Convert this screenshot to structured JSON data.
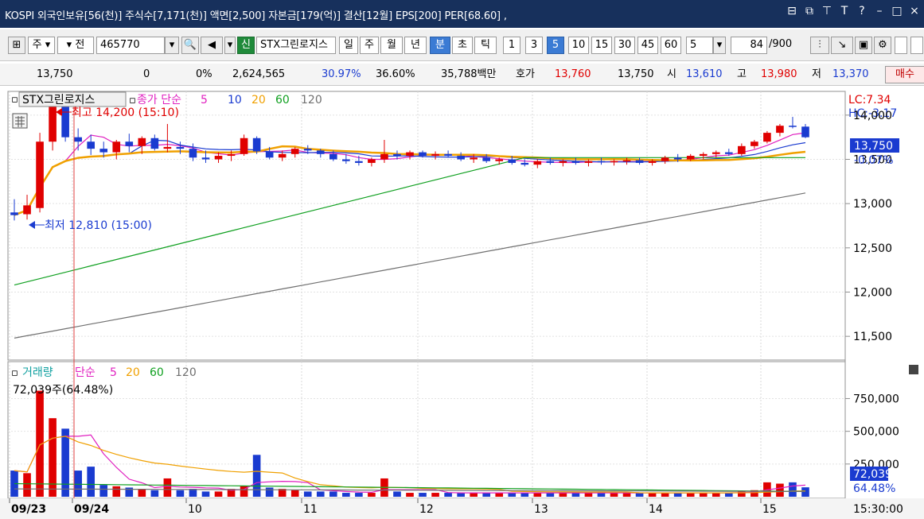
{
  "titlebar": {
    "text": "KOSPI 외국인보유[56(천)] 주식수[7,171(천)] 액면[2,500] 자본금[179(억)] 결산[12월] EPS[200] PER[68.60] ,",
    "icons": [
      "split-icon",
      "popup-icon",
      "pin-icon",
      "font-icon",
      "help-icon",
      "minimize-icon",
      "maximize-icon",
      "close-icon"
    ]
  },
  "toolbar": {
    "period_ju": "주",
    "jeon": "전",
    "stock_code": "465770",
    "shin": "신",
    "stock_name": "STX그린로지스",
    "periods": [
      "일",
      "주",
      "월",
      "년",
      "분",
      "초",
      "틱"
    ],
    "minutes": [
      "1",
      "3",
      "5",
      "10",
      "15",
      "30",
      "45",
      "60"
    ],
    "selected_period": "분",
    "selected_minute": "5",
    "interval_value": "5",
    "count": "84",
    "total": "/900"
  },
  "quote": {
    "price": "13,750",
    "change": "0",
    "change_pct": "0%",
    "volume": "2,624,565",
    "vol_ratio": "30.97%",
    "turnover": "36.60%",
    "amount": "35,788백만",
    "hoga_label": "호가",
    "hoga_ask": "13,760",
    "hoga_bid": "13,750",
    "open_label": "시",
    "open": "13,610",
    "high_label": "고",
    "high": "13,980",
    "low_label": "저",
    "low": "13,370",
    "buy_label": "매수"
  },
  "price_panel": {
    "name": "STX그린로지스",
    "legend_prefix": "종가 단순",
    "ma": [
      "5",
      "10",
      "20",
      "60",
      "120"
    ],
    "ma_colors": [
      "#e020c0",
      "#1a3bd0",
      "#f0a000",
      "#10a020",
      "#707070"
    ],
    "high_note": "최고 14,200 (15:10)",
    "low_note": "최저 12,810 (15:00)",
    "lc": "LC:7.34",
    "hc": "HC:-3.17",
    "price_tag": "13,750",
    "price_tag_pct": "-0.07%",
    "yaxis": [
      "14,000",
      "13,500",
      "13,000",
      "12,500",
      "12,000",
      "11,500"
    ]
  },
  "volume_panel": {
    "name": "거래량",
    "legend_prefix": "단순",
    "ma": [
      "5",
      "20",
      "60",
      "120"
    ],
    "info": "72,039주(64.48%)",
    "yaxis": [
      "750,000",
      "500,000",
      "250,000"
    ],
    "vol_tag": "72,039",
    "vol_tag_pct": "64.48%"
  },
  "xaxis": [
    "09/23",
    "09/24",
    "10",
    "11",
    "12",
    "13",
    "14",
    "15"
  ],
  "time_label": "15:30:00",
  "chart_data": {
    "type": "candlestick",
    "price_ylim": [
      11250,
      14250
    ],
    "volume_ylim": [
      0,
      850000
    ],
    "candles": [
      {
        "o": 12900,
        "h": 13050,
        "l": 12810,
        "c": 12870,
        "v": 200000
      },
      {
        "o": 12880,
        "h": 13100,
        "l": 12820,
        "c": 12980,
        "v": 180000
      },
      {
        "o": 12950,
        "h": 13800,
        "l": 12900,
        "c": 13700,
        "v": 810000
      },
      {
        "o": 13700,
        "h": 14200,
        "l": 13600,
        "c": 14100,
        "v": 600000
      },
      {
        "o": 14100,
        "h": 14200,
        "l": 13700,
        "c": 13750,
        "v": 520000
      },
      {
        "o": 13750,
        "h": 13850,
        "l": 13600,
        "c": 13700,
        "v": 200000
      },
      {
        "o": 13700,
        "h": 13780,
        "l": 13550,
        "c": 13620,
        "v": 230000
      },
      {
        "o": 13620,
        "h": 13700,
        "l": 13520,
        "c": 13580,
        "v": 90000
      },
      {
        "o": 13580,
        "h": 13720,
        "l": 13500,
        "c": 13700,
        "v": 80000
      },
      {
        "o": 13700,
        "h": 13790,
        "l": 13580,
        "c": 13650,
        "v": 70000
      },
      {
        "o": 13650,
        "h": 13760,
        "l": 13560,
        "c": 13740,
        "v": 60000
      },
      {
        "o": 13740,
        "h": 13780,
        "l": 13600,
        "c": 13620,
        "v": 50000
      },
      {
        "o": 13620,
        "h": 13900,
        "l": 13580,
        "c": 13640,
        "v": 140000
      },
      {
        "o": 13640,
        "h": 13700,
        "l": 13560,
        "c": 13620,
        "v": 50000
      },
      {
        "o": 13620,
        "h": 13680,
        "l": 13480,
        "c": 13520,
        "v": 60000
      },
      {
        "o": 13520,
        "h": 13600,
        "l": 13460,
        "c": 13500,
        "v": 40000
      },
      {
        "o": 13500,
        "h": 13580,
        "l": 13460,
        "c": 13540,
        "v": 40000
      },
      {
        "o": 13540,
        "h": 13600,
        "l": 13480,
        "c": 13560,
        "v": 60000
      },
      {
        "o": 13560,
        "h": 13780,
        "l": 13540,
        "c": 13740,
        "v": 80000
      },
      {
        "o": 13740,
        "h": 13760,
        "l": 13560,
        "c": 13590,
        "v": 320000
      },
      {
        "o": 13590,
        "h": 13640,
        "l": 13500,
        "c": 13520,
        "v": 70000
      },
      {
        "o": 13520,
        "h": 13600,
        "l": 13480,
        "c": 13560,
        "v": 60000
      },
      {
        "o": 13560,
        "h": 13640,
        "l": 13520,
        "c": 13620,
        "v": 50000
      },
      {
        "o": 13620,
        "h": 13660,
        "l": 13560,
        "c": 13600,
        "v": 40000
      },
      {
        "o": 13600,
        "h": 13620,
        "l": 13520,
        "c": 13560,
        "v": 40000
      },
      {
        "o": 13560,
        "h": 13600,
        "l": 13480,
        "c": 13500,
        "v": 40000
      },
      {
        "o": 13500,
        "h": 13560,
        "l": 13450,
        "c": 13480,
        "v": 30000
      },
      {
        "o": 13480,
        "h": 13540,
        "l": 13430,
        "c": 13460,
        "v": 30000
      },
      {
        "o": 13460,
        "h": 13520,
        "l": 13420,
        "c": 13500,
        "v": 30000
      },
      {
        "o": 13500,
        "h": 13720,
        "l": 13460,
        "c": 13560,
        "v": 140000
      },
      {
        "o": 13560,
        "h": 13600,
        "l": 13500,
        "c": 13540,
        "v": 40000
      },
      {
        "o": 13540,
        "h": 13600,
        "l": 13500,
        "c": 13580,
        "v": 30000
      },
      {
        "o": 13580,
        "h": 13600,
        "l": 13520,
        "c": 13540,
        "v": 30000
      },
      {
        "o": 13540,
        "h": 13590,
        "l": 13500,
        "c": 13560,
        "v": 30000
      },
      {
        "o": 13560,
        "h": 13600,
        "l": 13520,
        "c": 13540,
        "v": 30000
      },
      {
        "o": 13540,
        "h": 13580,
        "l": 13480,
        "c": 13500,
        "v": 30000
      },
      {
        "o": 13500,
        "h": 13560,
        "l": 13460,
        "c": 13520,
        "v": 30000
      },
      {
        "o": 13520,
        "h": 13560,
        "l": 13460,
        "c": 13480,
        "v": 30000
      },
      {
        "o": 13480,
        "h": 13520,
        "l": 13440,
        "c": 13500,
        "v": 30000
      },
      {
        "o": 13500,
        "h": 13540,
        "l": 13440,
        "c": 13460,
        "v": 30000
      },
      {
        "o": 13460,
        "h": 13500,
        "l": 13420,
        "c": 13440,
        "v": 30000
      },
      {
        "o": 13440,
        "h": 13500,
        "l": 13400,
        "c": 13480,
        "v": 30000
      },
      {
        "o": 13480,
        "h": 13520,
        "l": 13440,
        "c": 13460,
        "v": 30000
      },
      {
        "o": 13460,
        "h": 13500,
        "l": 13420,
        "c": 13480,
        "v": 30000
      },
      {
        "o": 13480,
        "h": 13520,
        "l": 13440,
        "c": 13460,
        "v": 30000
      },
      {
        "o": 13460,
        "h": 13500,
        "l": 13420,
        "c": 13480,
        "v": 30000
      },
      {
        "o": 13480,
        "h": 13520,
        "l": 13440,
        "c": 13470,
        "v": 30000
      },
      {
        "o": 13470,
        "h": 13500,
        "l": 13430,
        "c": 13480,
        "v": 30000
      },
      {
        "o": 13480,
        "h": 13520,
        "l": 13440,
        "c": 13490,
        "v": 30000
      },
      {
        "o": 13490,
        "h": 13520,
        "l": 13440,
        "c": 13460,
        "v": 30000
      },
      {
        "o": 13460,
        "h": 13500,
        "l": 13430,
        "c": 13480,
        "v": 30000
      },
      {
        "o": 13480,
        "h": 13540,
        "l": 13450,
        "c": 13520,
        "v": 30000
      },
      {
        "o": 13520,
        "h": 13560,
        "l": 13470,
        "c": 13500,
        "v": 30000
      },
      {
        "o": 13500,
        "h": 13560,
        "l": 13480,
        "c": 13540,
        "v": 30000
      },
      {
        "o": 13540,
        "h": 13580,
        "l": 13500,
        "c": 13560,
        "v": 30000
      },
      {
        "o": 13560,
        "h": 13600,
        "l": 13520,
        "c": 13580,
        "v": 30000
      },
      {
        "o": 13580,
        "h": 13620,
        "l": 13540,
        "c": 13560,
        "v": 30000
      },
      {
        "o": 13560,
        "h": 13680,
        "l": 13540,
        "c": 13650,
        "v": 40000
      },
      {
        "o": 13650,
        "h": 13720,
        "l": 13620,
        "c": 13700,
        "v": 50000
      },
      {
        "o": 13700,
        "h": 13820,
        "l": 13680,
        "c": 13800,
        "v": 110000
      },
      {
        "o": 13800,
        "h": 13900,
        "l": 13760,
        "c": 13880,
        "v": 100000
      },
      {
        "o": 13880,
        "h": 13980,
        "l": 13850,
        "c": 13870,
        "v": 110000
      },
      {
        "o": 13870,
        "h": 13900,
        "l": 13740,
        "c": 13750,
        "v": 72039
      }
    ]
  }
}
